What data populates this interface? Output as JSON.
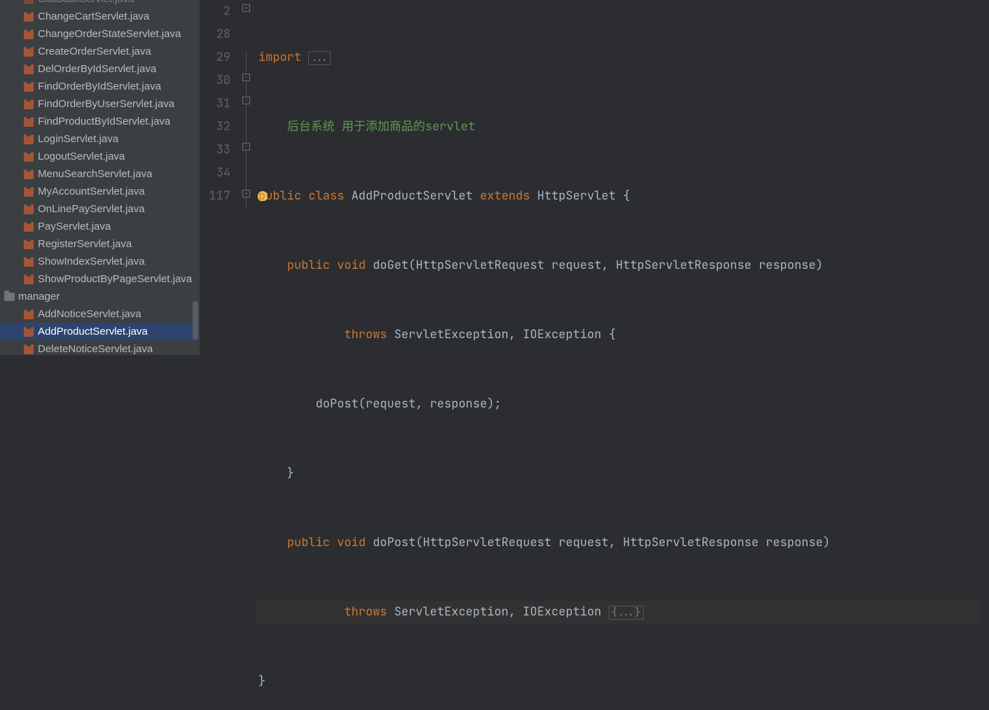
{
  "sidebar": {
    "files_top": [
      "CallBackServlet.java",
      "ChangeCartServlet.java",
      "ChangeOrderStateServlet.java",
      "CreateOrderServlet.java",
      "DelOrderByIdServlet.java",
      "FindOrderByIdServlet.java",
      "FindOrderByUserServlet.java",
      "FindProductByIdServlet.java",
      "LoginServlet.java",
      "LogoutServlet.java",
      "MenuSearchServlet.java",
      "MyAccountServlet.java",
      "OnLinePayServlet.java",
      "PayServlet.java",
      "RegisterServlet.java",
      "ShowIndexServlet.java",
      "ShowProductByPageServlet.java"
    ],
    "folder": "manager",
    "files_manager": [
      "AddNoticeServlet.java",
      "AddProductServlet.java",
      "DeleteNoticeServlet.java"
    ],
    "selected": "AddProductServlet.java"
  },
  "editor": {
    "line_numbers": [
      "2",
      "",
      "28",
      "29",
      "30",
      "31",
      "32",
      "33",
      "34",
      "117"
    ],
    "comment_text": "后台系统 用于添加商品的servlet",
    "tokens": {
      "import": "import",
      "public": "public",
      "class": "class",
      "void": "void",
      "extends": "extends",
      "throws": "throws",
      "class_name": "AddProductServlet",
      "super_name": "HttpServlet",
      "doGet": "doGet",
      "doPost": "doPost",
      "req_type": "HttpServletRequest",
      "req_name": "request",
      "res_type": "HttpServletResponse",
      "res_name": "response",
      "exc1": "ServletException",
      "exc2": "IOException",
      "call": "doPost(request, response);",
      "ellipsis": "...",
      "fold_body": "{...}"
    }
  }
}
